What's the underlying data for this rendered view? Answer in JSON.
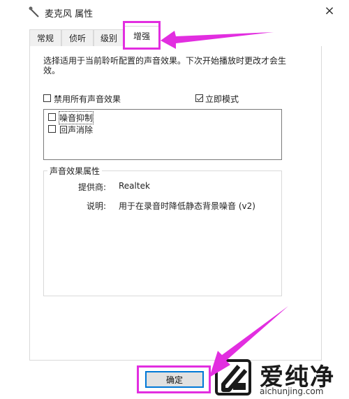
{
  "window": {
    "title": "麦克风 属性",
    "close_glyph": "×"
  },
  "tabs": [
    {
      "label": "常规"
    },
    {
      "label": "侦听"
    },
    {
      "label": "级别"
    },
    {
      "label": "增强",
      "active": true
    }
  ],
  "enhance": {
    "description": "选择适用于当前聆听配置的声音效果。下次开始播放时更改才会生效。",
    "disable_all": {
      "label": "禁用所有声音效果",
      "checked": false
    },
    "immediate_mode": {
      "label": "立即模式",
      "checked": true
    },
    "effects": [
      {
        "label": "噪音抑制",
        "checked": false,
        "focused": true
      },
      {
        "label": "回声消除",
        "checked": false
      }
    ]
  },
  "properties": {
    "title": "声音效果属性",
    "provider_label": "提供商:",
    "provider_value": "Realtek",
    "description_label": "说明:",
    "description_value": "用于在录音时降低静态背景噪音 (v2)"
  },
  "buttons": {
    "ok": "确定"
  },
  "watermark": {
    "title": "爱纯净",
    "url": "aichunjing.com"
  },
  "colors": {
    "annotation": "#e22ee0",
    "focus_border": "#0078d7"
  }
}
